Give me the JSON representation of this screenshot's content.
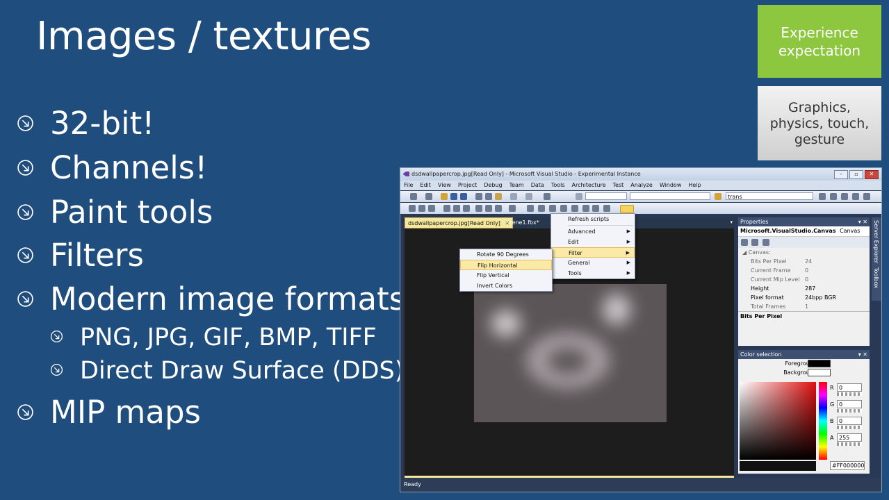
{
  "slide": {
    "title": "Images / textures",
    "bullets": [
      {
        "text": "32-bit!",
        "level": 1
      },
      {
        "text": "Channels!",
        "level": 1
      },
      {
        "text": "Paint tools",
        "level": 1
      },
      {
        "text": "Filters",
        "level": 1
      },
      {
        "text": "Modern image formats",
        "level": 1
      },
      {
        "text": "PNG, JPG, GIF, BMP, TIFF",
        "level": 2
      },
      {
        "text": "Direct Draw Surface (DDS)",
        "level": 2
      },
      {
        "text": "MIP maps",
        "level": 1
      }
    ],
    "bullet_icon": "arrow-circle-icon",
    "tiles": {
      "green": {
        "line1": "Experience",
        "line2": "expectation",
        "color": "#8dc63f"
      },
      "gray": {
        "line1": "Graphics,",
        "line2": "physics, touch,",
        "line3": "gesture"
      }
    }
  },
  "vs": {
    "title": "dsdwallpapercrop.jpg[Read Only] - Microsoft Visual Studio - Experimental Instance",
    "menu": [
      "File",
      "Edit",
      "View",
      "Project",
      "Debug",
      "Team",
      "Data",
      "Tools",
      "Architecture",
      "Test",
      "Analyze",
      "Window",
      "Help"
    ],
    "search_combo": "trans",
    "tabs": {
      "active": "dsdwallpapercrop.jpg[Read Only]",
      "close": "✕",
      "inactive": "scene1.fbx*"
    },
    "context_menu": [
      {
        "label": "Refresh scripts",
        "submenu": false
      },
      {
        "label": "Advanced",
        "submenu": true
      },
      {
        "label": "Edit",
        "submenu": true
      },
      {
        "label": "Filter",
        "submenu": true
      },
      {
        "label": "General",
        "submenu": true
      },
      {
        "label": "Tools",
        "submenu": true
      }
    ],
    "filter_menu": [
      "Rotate 90 Degrees",
      "Flip Horizontal",
      "Flip Vertical",
      "Invert Colors"
    ],
    "properties": {
      "header": "Properties",
      "object": "Microsoft.VisualStudio.Canvas",
      "object_type": "Canvas",
      "section": "Canvas:",
      "rows": [
        {
          "k": "Bits Per Pixel",
          "v": "24",
          "bold": false
        },
        {
          "k": "Current Frame",
          "v": "0",
          "bold": false
        },
        {
          "k": "Current Mip Level",
          "v": "0",
          "bold": false
        },
        {
          "k": "Height",
          "v": "287",
          "bold": true
        },
        {
          "k": "Pixel format",
          "v": "24bpp BGR",
          "bold": true
        },
        {
          "k": "Total Frames",
          "v": "1",
          "bold": false
        }
      ],
      "description": "Bits Per Pixel"
    },
    "color_selection": {
      "header": "Color selection",
      "foreground_label": "Foreground",
      "background_label": "Background",
      "channels": [
        {
          "label": "R",
          "value": "0"
        },
        {
          "label": "G",
          "value": "0"
        },
        {
          "label": "B",
          "value": "0"
        },
        {
          "label": "A",
          "value": "255"
        }
      ],
      "hex": "#FF000000"
    },
    "side_tabs": [
      "Server Explorer",
      "Toolbox"
    ],
    "status": "Ready"
  }
}
